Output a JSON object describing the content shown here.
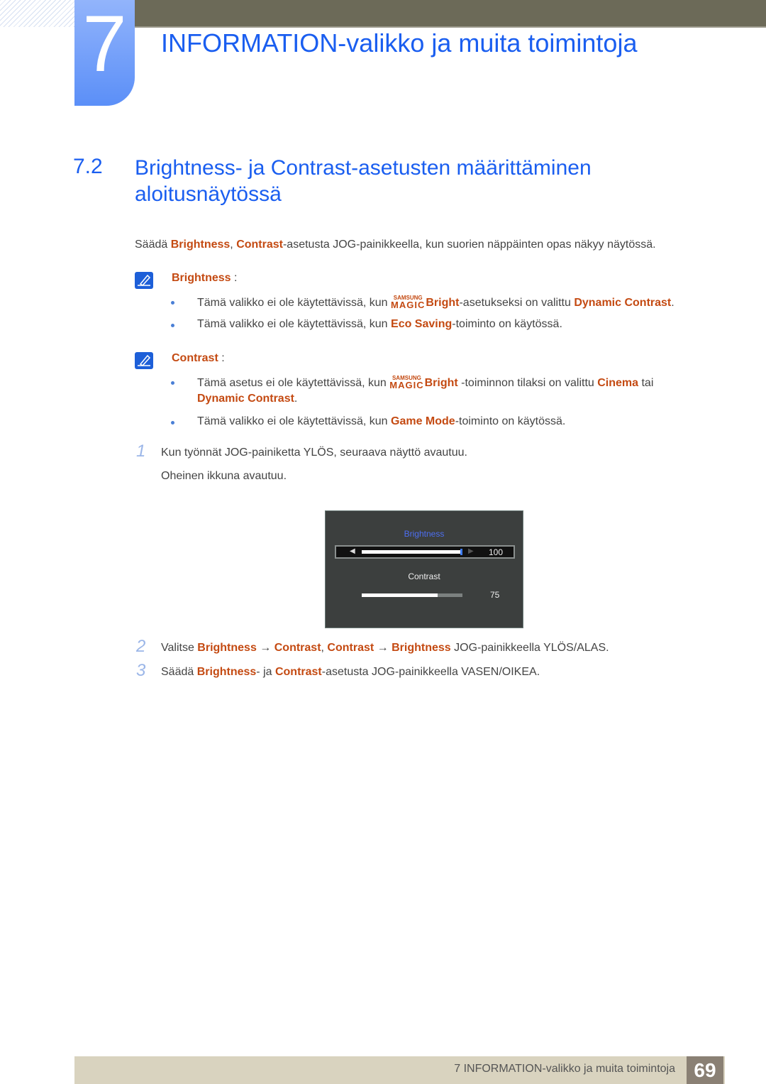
{
  "header": {
    "chapter_number": "7",
    "chapter_title": "INFORMATION-valikko ja muita toimintoja"
  },
  "section": {
    "number": "7.2",
    "title": "Brightness- ja Contrast-asetusten määrittäminen aloitusnäytössä"
  },
  "intro": {
    "t1": "Säädä ",
    "h1": "Brightness",
    "t2": ", ",
    "h2": "Contrast",
    "t3": "-asetusta JOG-painikkeella, kun suorien näppäinten opas näkyy näytössä."
  },
  "notes": [
    {
      "title": "Brightness",
      "suffix": " :",
      "icon": "note-pencil-icon",
      "items": [
        {
          "t1": "Tämä valikko ei ole käytettävissä, kun ",
          "magic_top": "SAMSUNG",
          "magic_bottom": "MAGIC",
          "h1": "Bright",
          "t2": "-asetukseksi on valittu ",
          "h2": "Dynamic Contrast",
          "t3": "."
        },
        {
          "t1": "Tämä valikko ei ole käytettävissä, kun ",
          "h1": "Eco Saving",
          "t2": "-toiminto on käytössä."
        }
      ]
    },
    {
      "title": "Contrast",
      "suffix": " :",
      "icon": "note-pencil-icon",
      "items": [
        {
          "t1": "Tämä asetus ei ole käytettävissä, kun ",
          "magic_top": "SAMSUNG",
          "magic_bottom": "MAGIC",
          "h1": "Bright",
          "t2": " -toiminnon tilaksi on valittu ",
          "h2": "Cinema",
          "t3": " tai",
          "line2_h": "Dynamic Contrast",
          "line2_t": "."
        },
        {
          "t1": "Tämä valikko ei ole käytettävissä, kun ",
          "h1": "Game Mode",
          "t2": "-toiminto on käytössä."
        }
      ]
    }
  ],
  "steps": [
    {
      "num": "1",
      "text": "Kun työnnät JOG-painiketta YLÖS, seuraava näyttö avautuu.",
      "subtext": "Oheinen ikkuna avautuu."
    },
    {
      "num": "2",
      "t1": "Valitse ",
      "h1": "Brightness",
      "a1": " → ",
      "h2": "Contrast",
      "t2": ", ",
      "h3": "Contrast",
      "a2": " → ",
      "h4": "Brightness",
      "t3": " JOG-painikkeella YLÖS/ALAS."
    },
    {
      "num": "3",
      "t1": "Säädä ",
      "h1": "Brightness",
      "t2": "- ja ",
      "h2": "Contrast",
      "t3": "-asetusta JOG-painikkeella VASEN/OIKEA."
    }
  ],
  "osd": {
    "brightness_label": "Brightness",
    "brightness_value": "100",
    "brightness_fraction": 1.0,
    "contrast_label": "Contrast",
    "contrast_value": "75",
    "contrast_fraction": 0.75,
    "left_arrow": "◀",
    "right_arrow": "▶",
    "active_color": "#4d6ef0"
  },
  "footer": {
    "text": "7 INFORMATION-valikko ja muita toimintoja",
    "page": "69"
  },
  "colors": {
    "heading": "#1a5ef0",
    "highlight": "#c44a12"
  }
}
